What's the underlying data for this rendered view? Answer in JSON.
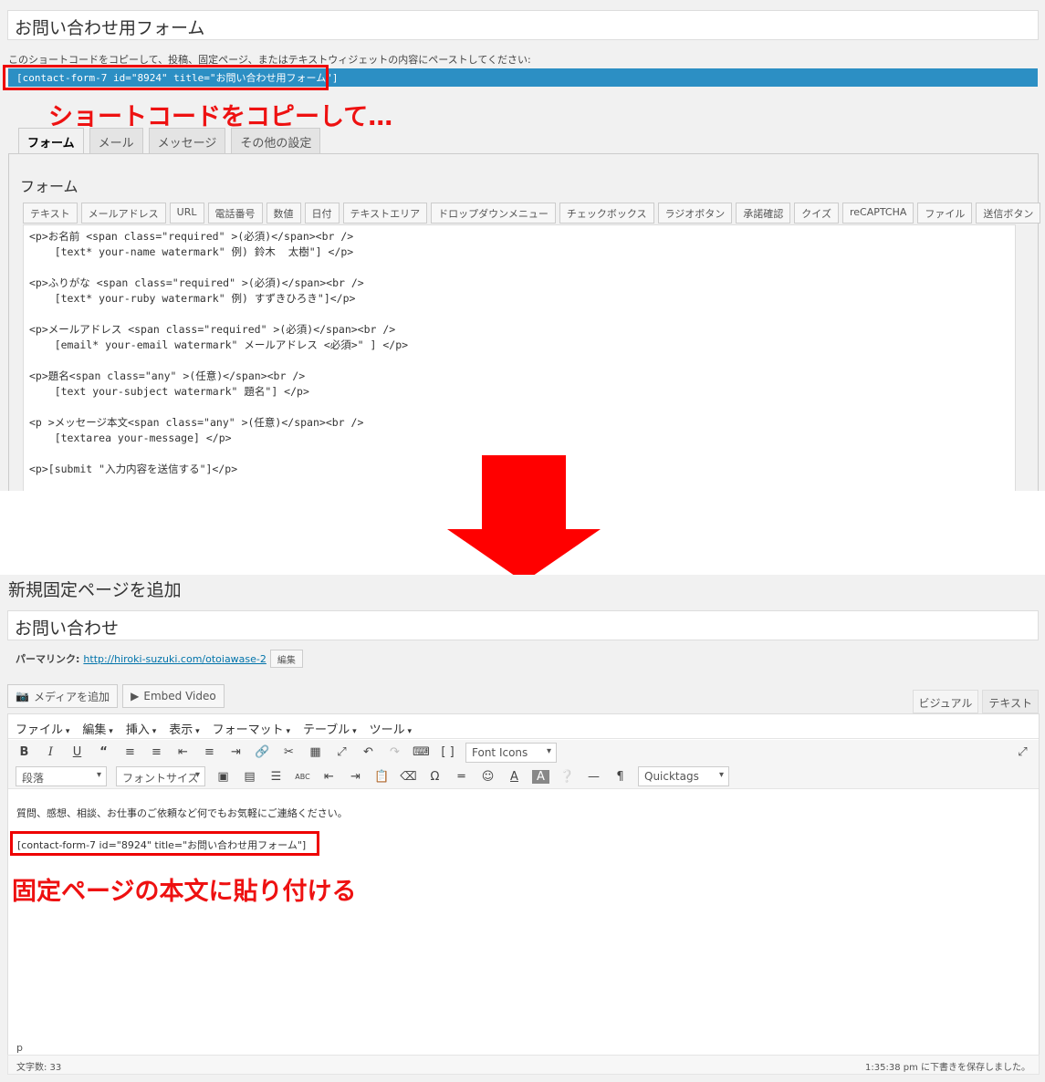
{
  "top_section": {
    "title_value": "お問い合わせ用フォーム",
    "instruction": "このショートコードをコピーして、投稿、固定ページ、またはテキストウィジェットの内容にペーストしてください:",
    "shortcode": "[contact-form-7 id=\"8924\" title=\"お問い合わせ用フォーム\"]",
    "callout": "ショートコードをコピーして…",
    "tabs": [
      "フォーム",
      "メール",
      "メッセージ",
      "その他の設定"
    ],
    "panel_heading": "フォーム",
    "tag_buttons": [
      "テキスト",
      "メールアドレス",
      "URL",
      "電話番号",
      "数値",
      "日付",
      "テキストエリア",
      "ドロップダウンメニュー",
      "チェックボックス",
      "ラジオボタン",
      "承諾確認",
      "クイズ",
      "reCAPTCHA",
      "ファイル",
      "送信ボタン"
    ],
    "code_lines": [
      "<p>お名前 <span class=\"required\" >(必須)</span><br />",
      "    [text* your-name watermark\" 例) 鈴木  太樹\"] </p>",
      "",
      "<p>ふりがな <span class=\"required\" >(必須)</span><br />",
      "    [text* your-ruby watermark\" 例) すずきひろき\"]</p>",
      "",
      "<p>メールアドレス <span class=\"required\" >(必須)</span><br />",
      "    [email* your-email watermark\" メールアドレス <必須>\" ] </p>",
      "",
      "<p>題名<span class=\"any\" >(任意)</span><br />",
      "    [text your-subject watermark\" 題名\"] </p>",
      "",
      "<p >メッセージ本文<span class=\"any\" >(任意)</span><br />",
      "    [textarea your-message] </p>",
      "",
      "<p>[submit \"入力内容を送信する\"]</p>"
    ]
  },
  "bottom_section": {
    "page_heading": "新規固定ページを追加",
    "title_value": "お問い合わせ",
    "permalink_label": "パーマリンク:",
    "permalink_base": "http://hiroki-suzuki.com/",
    "permalink_slug": "otoiawase-2",
    "edit_button": "編集",
    "add_media_label": "メディアを追加",
    "embed_video_label": "Embed Video",
    "editor_tabs": [
      "ビジュアル",
      "テキスト"
    ],
    "menu": [
      "ファイル",
      "編集",
      "挿入",
      "表示",
      "フォーマット",
      "テーブル",
      "ツール"
    ],
    "font_icons_select": "Font Icons",
    "paragraph_select": "段落",
    "font_size_select": "フォントサイズ",
    "quicktags_select": "Quicktags",
    "body_text": "質問、感想、相談、お仕事のご依頼など何でもお気軽にご連絡ください。",
    "shortcode": "[contact-form-7 id=\"8924\" title=\"お問い合わせ用フォーム\"]",
    "callout": "固定ページの本文に貼り付ける",
    "path": "p",
    "word_count": "文字数: 33",
    "save_status": "1:35:38 pm に下書きを保存しました。"
  },
  "colors": {
    "shortcode_bar": "#2c8fc4",
    "callout_red": "#ee1111",
    "arrow_red": "#ff0000"
  }
}
